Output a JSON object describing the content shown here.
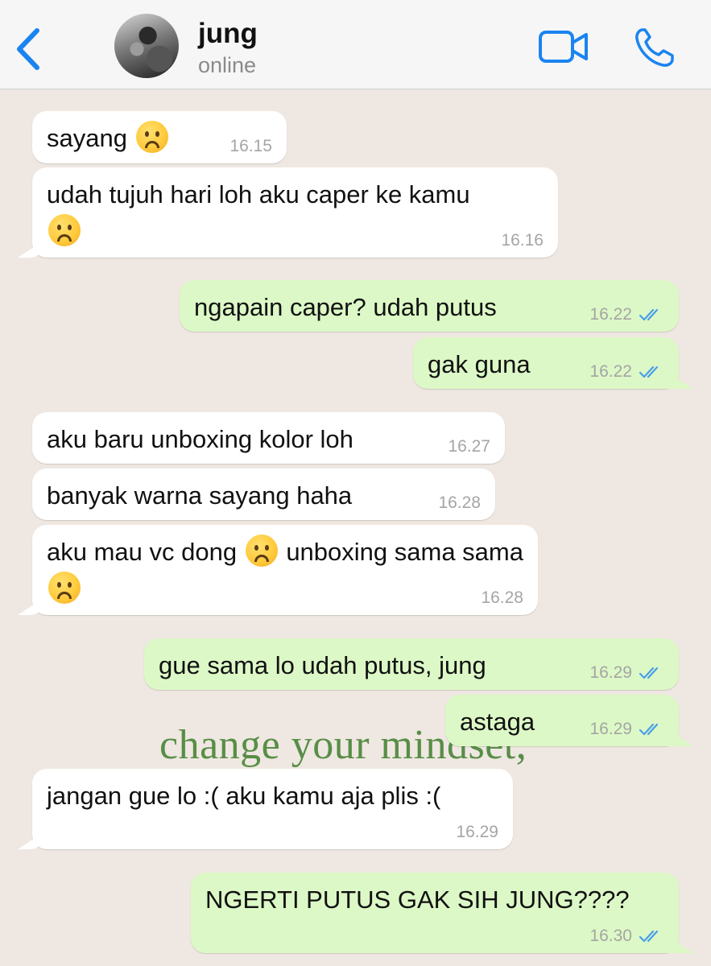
{
  "header": {
    "contact_name": "jung",
    "status": "online"
  },
  "messages": [
    {
      "text_parts": [
        "sayang "
      ],
      "emoji": true,
      "time": "16.15"
    },
    {
      "text_parts": [
        "udah tujuh hari loh aku caper ke kamu"
      ],
      "emoji": true,
      "time": "16.16"
    },
    {
      "text": "ngapain caper? udah putus",
      "time": "16.22"
    },
    {
      "text": "gak guna",
      "time": "16.22"
    },
    {
      "text": "aku baru unboxing kolor loh",
      "time": "16.27"
    },
    {
      "text": "banyak warna sayang haha",
      "time": "16.28"
    },
    {
      "text_parts": [
        "aku mau vc dong ",
        " unboxing sama sama "
      ],
      "time": "16.28"
    },
    {
      "text": "gue sama lo udah putus, jung",
      "time": "16.29"
    },
    {
      "text": "astaga",
      "time": "16.29"
    },
    {
      "text": "jangan gue lo :( aku kamu aja plis :(",
      "time": "16.29"
    },
    {
      "text": "NGERTI PUTUS GAK SIH JUNG????",
      "time": "16.30"
    }
  ],
  "watermark": "change your mindset,",
  "colors": {
    "accent": "#1a84f0",
    "background": "#efe7e1",
    "incoming_bubble": "#ffffff",
    "outgoing_bubble": "#dcf8c6",
    "read_ticks": "#4a9ee8",
    "watermark": "#4f8a3e"
  },
  "icons": [
    "back-chevron-icon",
    "video-camera-icon",
    "phone-icon",
    "sad-face-emoji",
    "read-receipt-icon"
  ]
}
